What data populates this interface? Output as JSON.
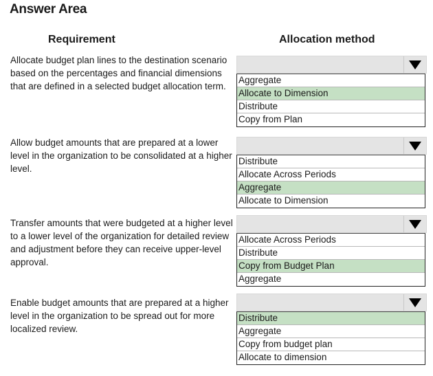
{
  "title": "Answer Area",
  "headers": {
    "requirement": "Requirement",
    "allocation_method": "Allocation method"
  },
  "rows": [
    {
      "requirement": "Allocate budget plan lines to the destination scenario based on the percentages and financial dimensions that are defined in a selected budget allocation term.",
      "selected_value": "",
      "options": [
        {
          "label": "Aggregate",
          "selected": false
        },
        {
          "label": "Allocate to Dimension",
          "selected": true
        },
        {
          "label": "Distribute",
          "selected": false
        },
        {
          "label": "Copy from Plan",
          "selected": false
        }
      ]
    },
    {
      "requirement": "Allow budget amounts that are prepared at a lower level in the organization to be consolidated at a higher level.",
      "selected_value": "",
      "options": [
        {
          "label": "Distribute",
          "selected": false
        },
        {
          "label": "Allocate Across Periods",
          "selected": false
        },
        {
          "label": "Aggregate",
          "selected": true
        },
        {
          "label": "Allocate to Dimension",
          "selected": false
        }
      ]
    },
    {
      "requirement": "Transfer amounts that were budgeted at a higher level to a lower level of the organization for detailed review and adjustment before they can receive upper-level approval.",
      "selected_value": "",
      "options": [
        {
          "label": "Allocate Across Periods",
          "selected": false
        },
        {
          "label": "Distribute",
          "selected": false
        },
        {
          "label": "Copy from Budget Plan",
          "selected": true
        },
        {
          "label": "Aggregate",
          "selected": false
        }
      ]
    },
    {
      "requirement": "Enable budget amounts that are prepared at a higher level in the organization to be spread out for more localized review.",
      "selected_value": "",
      "options": [
        {
          "label": "Distribute",
          "selected": true
        },
        {
          "label": "Aggregate",
          "selected": false
        },
        {
          "label": "Copy from budget plan",
          "selected": false
        },
        {
          "label": "Allocate to dimension",
          "selected": false
        }
      ]
    }
  ],
  "icons": {
    "dropdown": "triangle-down-icon"
  },
  "colors": {
    "selected_highlight": "#c5e0c4",
    "select_background": "#e4e4e4"
  }
}
